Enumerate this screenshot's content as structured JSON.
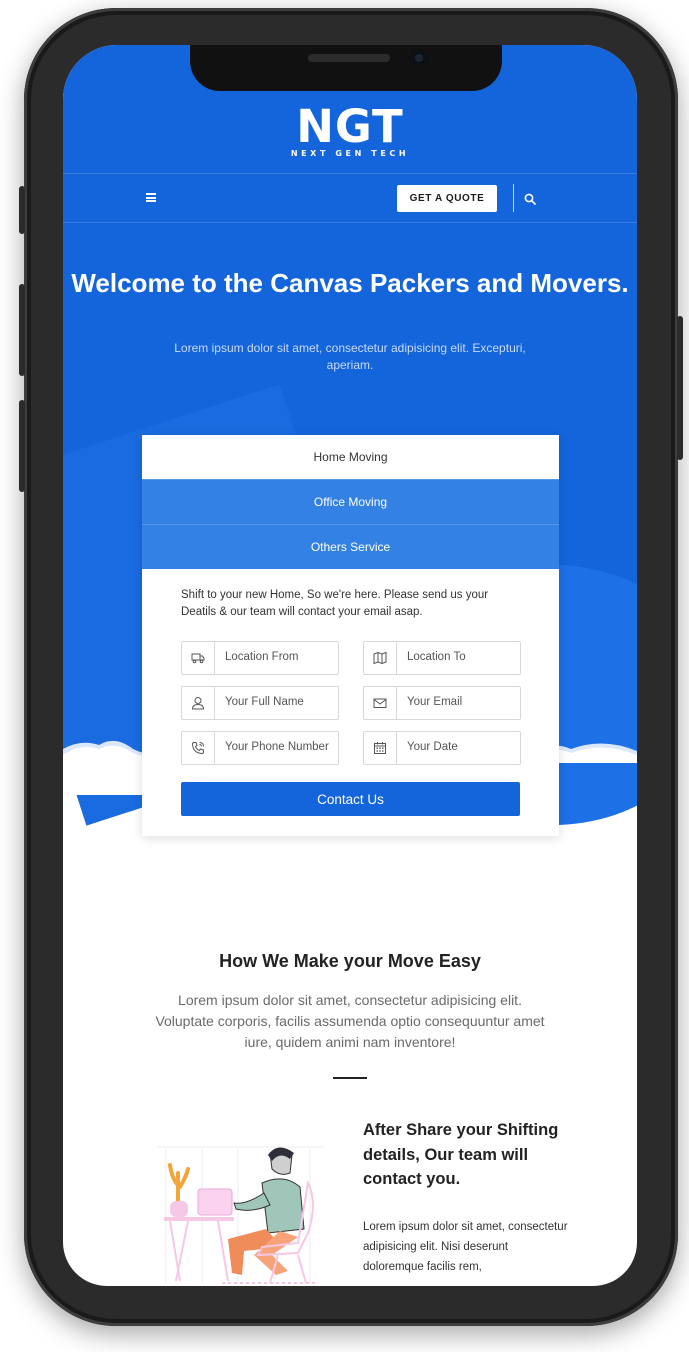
{
  "brand": {
    "logo_text": "NGT",
    "tagline": "NEXT GEN TECH"
  },
  "nav": {
    "quote_label": "GET A QUOTE"
  },
  "hero": {
    "title": "Welcome to the Canvas Packers and Movers.",
    "subtitle": "Lorem ipsum dolor sit amet, consectetur adipisicing elit. Excepturi, aperiam."
  },
  "tabs": [
    {
      "label": "Home Moving",
      "active": true
    },
    {
      "label": "Office Moving",
      "active": false
    },
    {
      "label": "Others Service",
      "active": false
    }
  ],
  "form": {
    "intro": "Shift to your new Home, So we're here. Please send us your Deatils & our team will contact your email asap.",
    "fields": {
      "location_from": {
        "placeholder": "Location From",
        "icon": "truck-icon"
      },
      "location_to": {
        "placeholder": "Location To",
        "icon": "map-icon"
      },
      "full_name": {
        "placeholder": "Your Full Name",
        "icon": "user-icon"
      },
      "email": {
        "placeholder": "Your Email",
        "icon": "envelope-icon"
      },
      "phone": {
        "placeholder": "Your Phone Number",
        "icon": "phone-icon"
      },
      "date": {
        "placeholder": "Your Date",
        "icon": "calendar-icon"
      }
    },
    "submit_label": "Contact Us"
  },
  "how": {
    "title": "How We Make your Move Easy",
    "text": "Lorem ipsum dolor sit amet, consectetur adipisicing elit. Voluptate corporis, facilis assumenda optio consequuntur amet iure, quidem animi nam inventore!"
  },
  "feature": {
    "title": "After Share your Shifting details, Our team will contact you.",
    "text": "Lorem ipsum dolor sit amet, consectetur adipisicing elit. Nisi deserunt doloremque facilis rem,"
  },
  "colors": {
    "primary": "#1465db",
    "tab_inactive": "#3481e4",
    "device_frame": "#2b2b2b"
  }
}
